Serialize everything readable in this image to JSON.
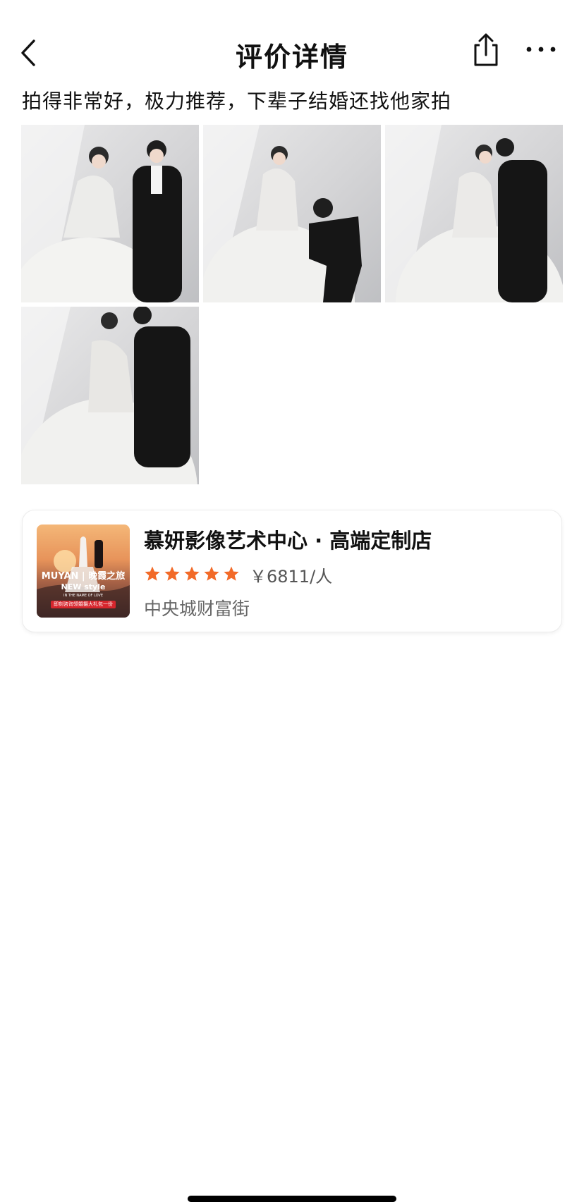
{
  "header": {
    "title": "评价详情",
    "back_icon": "chevron-left-icon",
    "share_icon": "share-icon",
    "more_icon": "more-horizontal-icon"
  },
  "review": {
    "text": "拍得非常好，极力推荐，下辈子结婚还找他家拍",
    "photos": [
      {
        "name": "review-photo-1",
        "subject": "wedding couple standing"
      },
      {
        "name": "review-photo-2",
        "subject": "groom kneeling proposal"
      },
      {
        "name": "review-photo-3",
        "subject": "couple kissing"
      },
      {
        "name": "review-photo-4",
        "subject": "couple embracing, back view"
      }
    ]
  },
  "shop": {
    "name": "慕妍影像艺术中心 · 高端定制店",
    "rating_stars": 5,
    "star_color": "#f26a28",
    "price": "￥6811/人",
    "address": "中央城财富街",
    "thumbnail": {
      "brand": "MUYAN | 晚霞之旅",
      "style": "NEW style",
      "subtitle": "IN THE NAME OF LOVE",
      "banner": "即刻咨询领婚摄大礼包一份"
    }
  }
}
